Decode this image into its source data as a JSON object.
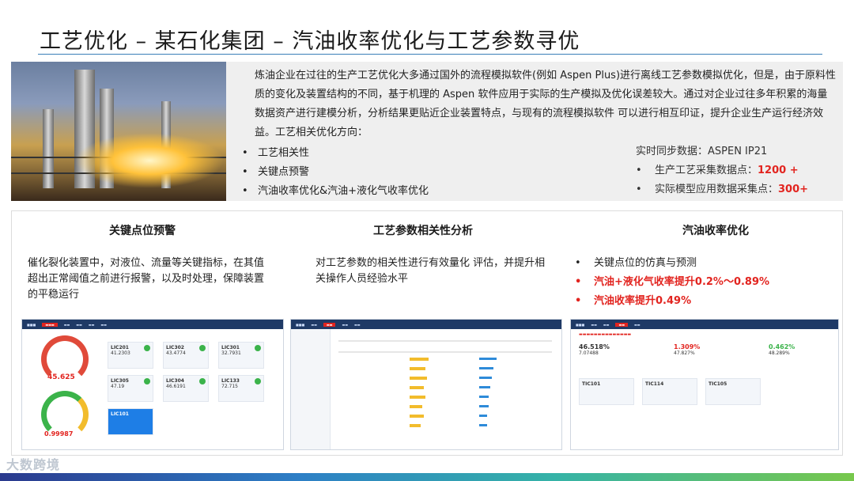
{
  "title": "工艺优化 – 某石化集团 – 汽油收率优化与工艺参数寻优",
  "intro": "炼油企业在过往的生产工艺优化大多通过国外的流程模拟软件(例如 Aspen Plus)进行离线工艺参数模拟优化，但是，由于原料性质的变化及装置结构的不同，基于机理的 Aspen 软件应用于实际的生产模拟及优化误差较大。通过对企业过往多年积累的海量数据资产进行建模分析，分析结果更贴近企业装置特点，与现有的流程模拟软件 可以进行相互印证，提升企业生产运行经济效益。工艺相关优化方向：",
  "directions": [
    "工艺相关性",
    "关键点预警",
    "汽油收率优化&汽油+液化气收率优化"
  ],
  "realtime": {
    "label": "实时同步数据：ASPEN IP21",
    "rows": [
      {
        "label": "生产工艺采集数据点：",
        "value": "1200 +"
      },
      {
        "label": "实际模型应用数据采集点：",
        "value": "300+"
      }
    ]
  },
  "columns": [
    {
      "title": "关键点位预警",
      "text": "催化裂化装置中，对液位、流量等关键指标，在其值超出正常阈值之前进行报警，以及时处理，保障装置的平稳运行"
    },
    {
      "title": "工艺参数相关性分析",
      "text": "对工艺参数的相关性进行有效量化 评估，并提升相关操作人员经验水平"
    },
    {
      "title": "汽油收率优化",
      "bullets": [
        "关键点位的仿真与预测",
        "汽油+液化气收率提升0.2%～0.89%",
        "汽油收率提升0.49%"
      ]
    }
  ],
  "shot1": {
    "gauge1": "45.625",
    "gauge2": "0.99987",
    "cards": [
      {
        "tag": "LIC201",
        "val": "41.2303"
      },
      {
        "tag": "LIC302",
        "val": "43.4774"
      },
      {
        "tag": "LIC301",
        "val": "32.7931"
      },
      {
        "tag": "LIC305",
        "val": "47.19"
      },
      {
        "tag": "LIC304",
        "val": "46.6191"
      },
      {
        "tag": "LIC133",
        "val": "72.715"
      },
      {
        "tag": "LIC101",
        "val": ""
      }
    ]
  },
  "shot3": {
    "metrics": [
      {
        "label": "46.518%",
        "sub": "7.07488"
      },
      {
        "label": "1.309%",
        "sub": "47.827%"
      },
      {
        "label": "0.462%",
        "sub": "48.289%"
      }
    ],
    "tags": [
      "TIC101",
      "TIC114",
      "TIC105"
    ]
  },
  "logo": "大数跨境",
  "colors": {
    "accent": "#e2241f",
    "navy": "#1f3a66",
    "rule": "#3a7fb8"
  }
}
